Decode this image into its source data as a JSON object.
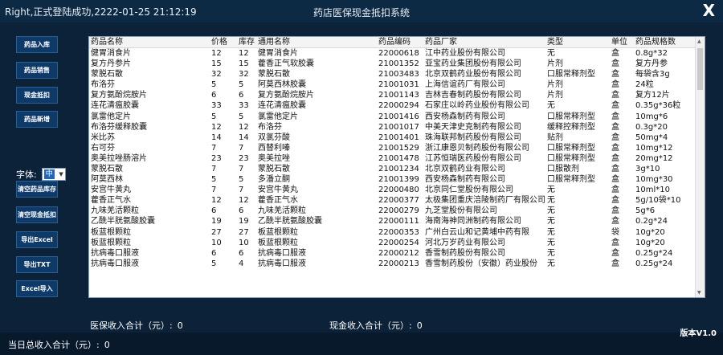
{
  "titlebar": {
    "status": "Right,正式登陆成功,2222-01-25 21:12:19",
    "title": "药店医保现金抵扣系统",
    "close_glyph": "X"
  },
  "sidebar": {
    "buttons": [
      {
        "key": "drug-in",
        "label": "药品入库"
      },
      {
        "key": "drug-sale",
        "label": "药品销售"
      },
      {
        "key": "cash-deduct",
        "label": "现金抵扣"
      },
      {
        "key": "drug-new",
        "label": "药品新增"
      },
      {
        "key": "clear-stock",
        "label": "清空药品库存"
      },
      {
        "key": "clear-deduct",
        "label": "清空现金抵扣"
      },
      {
        "key": "export-excel",
        "label": "导出Excel"
      },
      {
        "key": "export-txt",
        "label": "导出TXT"
      },
      {
        "key": "excel-import",
        "label": "Excel导入"
      }
    ],
    "font_label": "字体:",
    "font_value": "中"
  },
  "table": {
    "columns": [
      "药品名称",
      "价格",
      "库存",
      "通用名称",
      "药品编码",
      "药品厂家",
      "类型",
      "单位",
      "药品规格数"
    ],
    "rows": [
      [
        "健胃消食片",
        "12",
        "12",
        "健胃消食片",
        "22000618",
        "江中药业股份有限公司",
        "无",
        "盒",
        "0.8g*32"
      ],
      [
        "复方丹参片",
        "15",
        "15",
        "藿香正气软胶囊",
        "21001352",
        "亚宝药业集团股份有限公司",
        "片剂",
        "盒",
        "复方丹参"
      ],
      [
        "蒙脱石散",
        "32",
        "32",
        "蒙脱石散",
        "21003483",
        "北京双鹤药业股份有限公司",
        "口服常释剂型",
        "盒",
        "每袋含3g"
      ],
      [
        "布洛芬",
        "5",
        "5",
        "阿莫西林胶囊",
        "21001031",
        "上海信谊药厂有限公司",
        "片剂",
        "盒",
        "24粒"
      ],
      [
        "复方氨酚烷胺片",
        "6",
        "6",
        "复方氨酚烷胺片",
        "21001143",
        "吉林吉春制药股份有限公司",
        "片剂",
        "盒",
        "复方12片"
      ],
      [
        "连花清瘟胶囊",
        "33",
        "33",
        "连花清瘟胶囊",
        "22000294",
        "石家庄以岭药业股份有限公司",
        "无",
        "盒",
        "0.35g*36粒"
      ],
      [
        "氯雷他定片",
        "5",
        "5",
        "氯雷他定片",
        "21001416",
        "西安杨森制药有限公司",
        "口服常释剂型",
        "盒",
        "10mg*6"
      ],
      [
        "布洛芬缓释胶囊",
        "12",
        "12",
        "布洛芬",
        "21001017",
        "中美天津史克制药有限公司",
        "缓释控释剂型",
        "盒",
        "0.3g*20"
      ],
      [
        "米比苏",
        "14",
        "14",
        "双氯芬酸",
        "21001401",
        "珠海联邦制药股份有限公司",
        "贴剂",
        "盒",
        "50mg*4"
      ],
      [
        "右可芬",
        "7",
        "7",
        "西替利嗪",
        "21001529",
        "浙江康恩贝制药股份有限公司",
        "口服常释剂型",
        "盒",
        "10mg*12"
      ],
      [
        "奥美拉唑肠溶片",
        "23",
        "23",
        "奥美拉唑",
        "21001478",
        "江苏恒瑞医药股份有限公司",
        "口服常释剂型",
        "盒",
        "20mg*12"
      ],
      [
        "蒙脱石散",
        "7",
        "7",
        "蒙脱石散",
        "21001234",
        "北京双鹤药业有限公司",
        "口服散剂",
        "盒",
        "3g*10"
      ],
      [
        "阿莫西林",
        "5",
        "5",
        "多潘立酮",
        "21001399",
        "西安杨森制药有限公司",
        "口服常释剂型",
        "盒",
        "10mg*30"
      ],
      [
        "安宫牛黄丸",
        "7",
        "7",
        "安宫牛黄丸",
        "22000480",
        "北京同仁堂股份有限公司",
        "无",
        "盒",
        "10ml*10"
      ],
      [
        "藿香正气水",
        "12",
        "12",
        "藿香正气水",
        "22000377",
        "太极集团重庆涪陵制药厂有限公司",
        "无",
        "盒",
        "5g/10袋*10"
      ],
      [
        "九味羌活颗粒",
        "6",
        "6",
        "九味羌活颗粒",
        "22000279",
        "九芝堂股份有限公司",
        "无",
        "盒",
        "5g*6"
      ],
      [
        "乙酰半胱氨酸胶囊",
        "19",
        "19",
        "乙酰半胱氨酸胶囊",
        "22000111",
        "海南海神同洲制药有限公司",
        "无",
        "盒",
        "0.2g*24"
      ],
      [
        "板蓝根颗粒",
        "27",
        "27",
        "板蓝根颗粒",
        "22000353",
        "广州白云山和记黄埔中药有限",
        "无",
        "袋",
        "10g*20"
      ],
      [
        "板蓝根颗粒",
        "10",
        "10",
        "板蓝根颗粒",
        "22000254",
        "河北万岁药业有限公司",
        "无",
        "盒",
        "10g*20"
      ],
      [
        "抗病毒口服液",
        "6",
        "6",
        "抗病毒口服液",
        "22000212",
        "香雪制药股份有限公司",
        "无",
        "盒",
        "0.25g*24"
      ],
      [
        "抗病毒口服液",
        "5",
        "4",
        "抗病毒口服液",
        "22000213",
        "香雪制药股份（安徽）药业股份",
        "无",
        "盒",
        "0.25g*24"
      ]
    ]
  },
  "summary": {
    "medical_label": "医保收入合计（元）:",
    "medical_value": "0",
    "cash_label": "现金收入合计（元）:",
    "cash_value": "0",
    "day_label": "当日总收入合计（元）:",
    "day_value": "0"
  },
  "version": "版本V1.0",
  "colors": {
    "background": "#0b2238",
    "button": "#0e3a6a",
    "table_bg": "#ffffff"
  }
}
